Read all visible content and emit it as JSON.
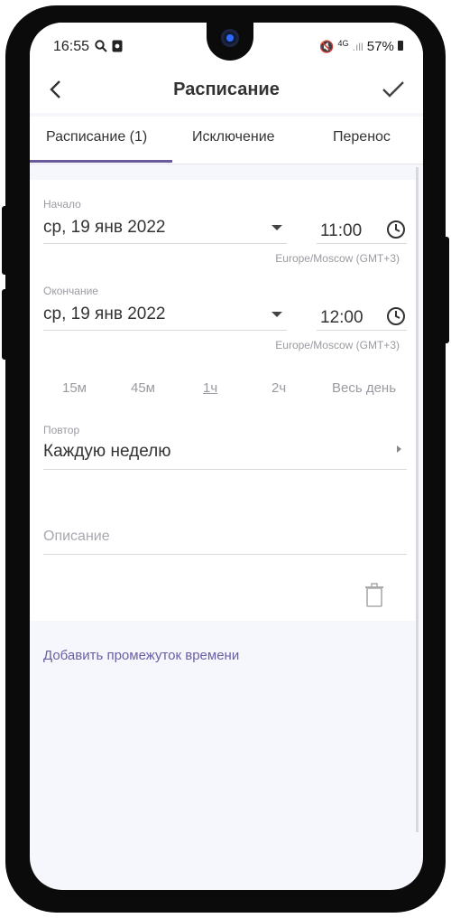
{
  "status": {
    "time": "16:55",
    "search_icon": "search-icon",
    "status_app_icon": "app-icon",
    "battery": "57%",
    "signal": "4G"
  },
  "toolbar": {
    "title": "Расписание",
    "back_icon": "back-arrow-icon",
    "confirm_icon": "check-icon"
  },
  "tabs": [
    {
      "label": "Расписание (1)",
      "active": true
    },
    {
      "label": "Исключение",
      "active": false
    },
    {
      "label": "Перенос",
      "active": false
    }
  ],
  "start": {
    "label": "Начало",
    "date": "ср, 19 янв 2022",
    "time": "11:00",
    "timezone": "Europe/Moscow (GMT+3)"
  },
  "end": {
    "label": "Окончание",
    "date": "ср, 19 янв 2022",
    "time": "12:00",
    "timezone": "Europe/Moscow (GMT+3)"
  },
  "durations": [
    {
      "label": "15м",
      "active": false
    },
    {
      "label": "45м",
      "active": false
    },
    {
      "label": "1ч",
      "active": true
    },
    {
      "label": "2ч",
      "active": false
    },
    {
      "label": "Весь день",
      "active": false
    }
  ],
  "repeat": {
    "label": "Повтор",
    "value": "Каждую неделю"
  },
  "description": {
    "placeholder": "Описание"
  },
  "actions": {
    "add_interval": "Добавить промежуток времени"
  },
  "colors": {
    "accent": "#6a5a9a",
    "background": "#f5f7fc"
  }
}
